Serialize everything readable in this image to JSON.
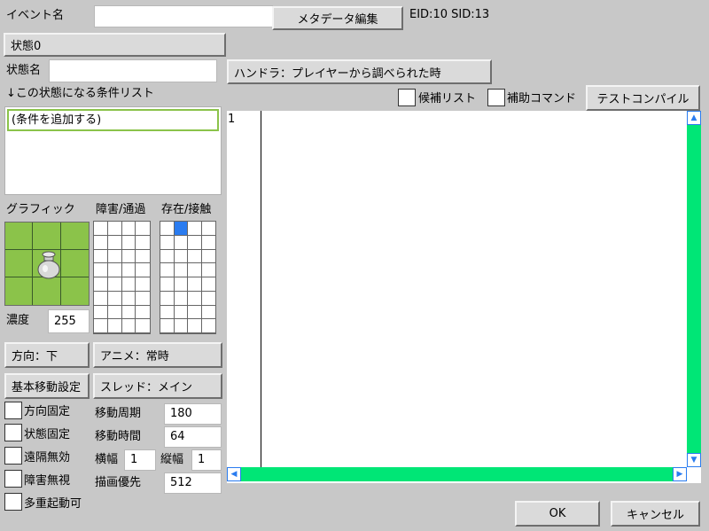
{
  "event": {
    "name_label": "イベント名",
    "name_value": "",
    "metadata_button": "メタデータ編集",
    "ids": "EID:10 SID:13"
  },
  "state": {
    "state_button": "状態0",
    "state_name_label": "状態名",
    "state_name_value": "",
    "handler_button": "ハンドラ：プレイヤーから調べられた時",
    "conditions_label": "↓この状態になる条件リスト",
    "conditions": [
      "(条件を追加する)"
    ]
  },
  "editor_toolbar": {
    "candidates_label": "候補リスト",
    "aux_commands_label": "補助コマンド",
    "test_compile_button": "テストコンパイル"
  },
  "editor": {
    "line_numbers": [
      "1"
    ],
    "code": ""
  },
  "graphics": {
    "graphic_label": "グラフィック",
    "obstacle_label": "障害/通過",
    "exist_label": "存在/接触",
    "density_label": "濃度",
    "density_value": "255",
    "graphic_icon": "pot-icon",
    "exist_selected_cell": 1
  },
  "buttons": {
    "direction": "方向：下",
    "anime": "アニメ：常時",
    "basic_move": "基本移動設定",
    "thread": "スレッド：メイン"
  },
  "checkboxes": [
    {
      "label": "方向固定",
      "checked": false
    },
    {
      "label": "状態固定",
      "checked": false
    },
    {
      "label": "遠隔無効",
      "checked": false
    },
    {
      "label": "障害無視",
      "checked": false
    },
    {
      "label": "多重起動可",
      "checked": false
    }
  ],
  "params": {
    "move_period_label": "移動周期",
    "move_period_value": "180",
    "move_time_label": "移動時間",
    "move_time_value": "64",
    "width_label": "横幅",
    "width_value": "1",
    "height_label": "縦幅",
    "height_value": "1",
    "draw_priority_label": "描画優先",
    "draw_priority_value": "512"
  },
  "footer": {
    "ok": "OK",
    "cancel": "キャンセル"
  },
  "colors": {
    "background": "#c8c8c8",
    "scrollbar": "#00e676",
    "scroll_arrow": "#2a7cf0",
    "graphic_bg": "#8bc34a",
    "selected_cell": "#2a7cf0",
    "condition_border": "#8bc34a"
  }
}
